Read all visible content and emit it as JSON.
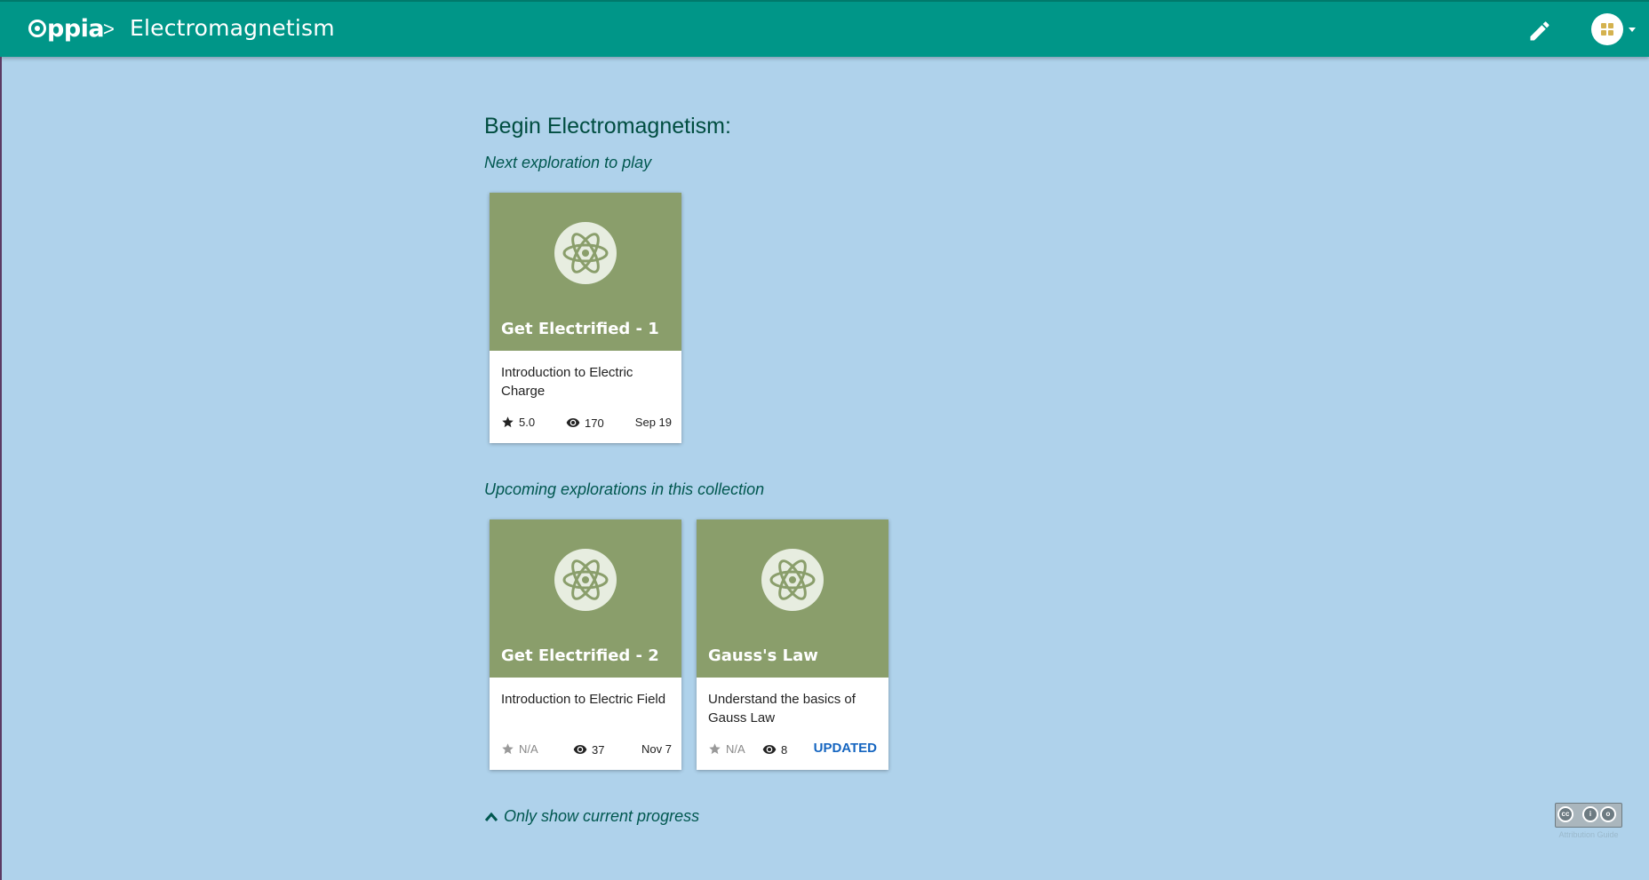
{
  "navbar": {
    "logo_text": "ppia",
    "separator": ">",
    "title": "Electromagnetism",
    "edit_icon": "pencil-icon",
    "profile_icon": "avatar-icon"
  },
  "main": {
    "heading": "Begin Electromagnetism:",
    "next_label": "Next exploration to play",
    "upcoming_label": "Upcoming explorations in this collection",
    "toggle_label": "Only show current progress"
  },
  "cards": [
    {
      "title": "Get Electrified - 1",
      "description": "Introduction to Electric Charge",
      "rating": "5.0",
      "views": "170",
      "date": "Sep 19"
    },
    {
      "title": "Get Electrified - 2",
      "description": "Introduction to Electric Field",
      "rating": "N/A",
      "views": "37",
      "date": "Nov 7"
    },
    {
      "title": "Gauss's Law",
      "description": "Understand the basics of Gauss Law",
      "rating": "N/A",
      "views": "8",
      "status": "UPDATED"
    }
  ],
  "footer": {
    "license_text": "Attribution Guide"
  },
  "colors": {
    "navbar": "#009688",
    "background": "#afd2eb",
    "card_header": "#8a9e6b",
    "heading_text": "#004d40",
    "updated_badge": "#1565c0"
  }
}
